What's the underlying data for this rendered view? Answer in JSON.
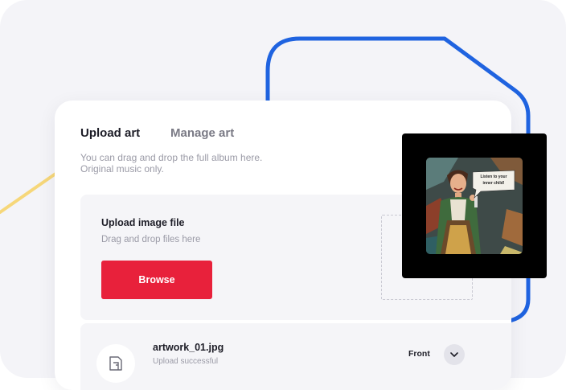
{
  "colors": {
    "background": "#f4f4f8",
    "accent": "#e8213b",
    "deco_blue": "#1f63e0",
    "deco_yellow": "#f6d77a"
  },
  "tabs": [
    {
      "label": "Upload art",
      "active": true
    },
    {
      "label": "Manage art",
      "active": false
    }
  ],
  "hint": {
    "line1": "You can drag and drop the full album here.",
    "line2": "Original music only."
  },
  "upload": {
    "title": "Upload image file",
    "subtitle": "Drag and drop files here",
    "browse_label": "Browse"
  },
  "file": {
    "name": "artwork_01.jpg",
    "status": "Upload successful",
    "side": "Front",
    "thumb_icon": "image-file-icon",
    "toggle_icon": "chevron-down-icon"
  },
  "preview": {
    "speech": "Listen to your inner child!"
  }
}
